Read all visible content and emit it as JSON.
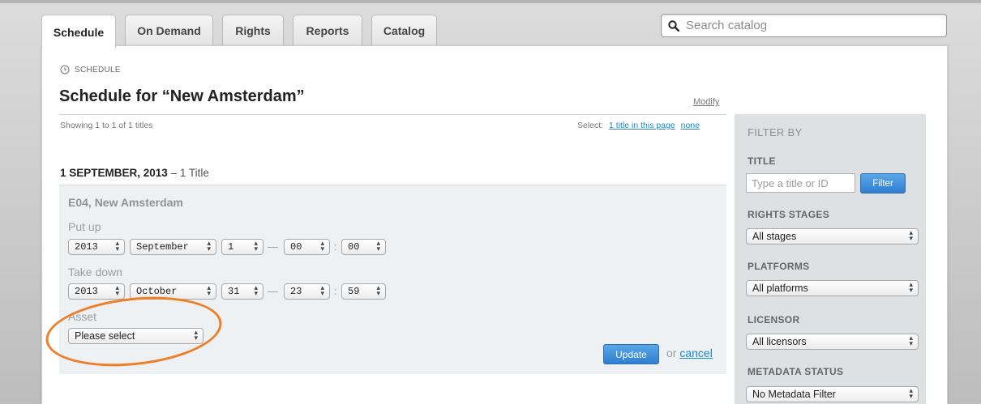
{
  "tabs": [
    {
      "label": "Schedule",
      "active": true
    },
    {
      "label": "On Demand"
    },
    {
      "label": "Rights"
    },
    {
      "label": "Reports"
    },
    {
      "label": "Catalog"
    }
  ],
  "search": {
    "placeholder": "Search catalog"
  },
  "breadcrumb": "SCHEDULE",
  "page_title": "Schedule for “New Amsterdam”",
  "modify_label": "Modify",
  "showing_text": "Showing 1 to 1 of 1 titles",
  "select": {
    "label": "Select:",
    "page_link": "1 title in this page",
    "none_link": "none"
  },
  "date_group": {
    "date": "1 SEPTEMBER, 2013",
    "count": " – 1 Title"
  },
  "entry": {
    "title": "E04, New Amsterdam",
    "put_up": {
      "label": "Put up",
      "year": "2013",
      "month": "September",
      "day": "1",
      "hour": "00",
      "minute": "00"
    },
    "take_down": {
      "label": "Take down",
      "year": "2013",
      "month": "October",
      "day": "31",
      "hour": "23",
      "minute": "59"
    },
    "asset": {
      "label": "Asset",
      "value": "Please select"
    },
    "update_label": "Update",
    "or_text": "or ",
    "cancel_label": "cancel"
  },
  "filter": {
    "heading": "FILTER BY",
    "title_label": "TITLE",
    "title_placeholder": "Type a title or ID",
    "filter_button": "Filter",
    "rights_label": "RIGHTS STAGES",
    "rights_value": "All stages",
    "platforms_label": "PLATFORMS",
    "platforms_value": "All platforms",
    "licensor_label": "LICENSOR",
    "licensor_value": "All licensors",
    "metadata_label": "METADATA STATUS",
    "metadata_value": "No Metadata Filter"
  },
  "colors": {
    "accent_blue": "#2f7fd0",
    "link_blue": "#1a8acb",
    "highlight_orange": "#f07e26"
  },
  "icons": {
    "search": "magnifier-icon",
    "clock": "clock-icon",
    "select_arrows": "up-down-arrows-icon"
  }
}
